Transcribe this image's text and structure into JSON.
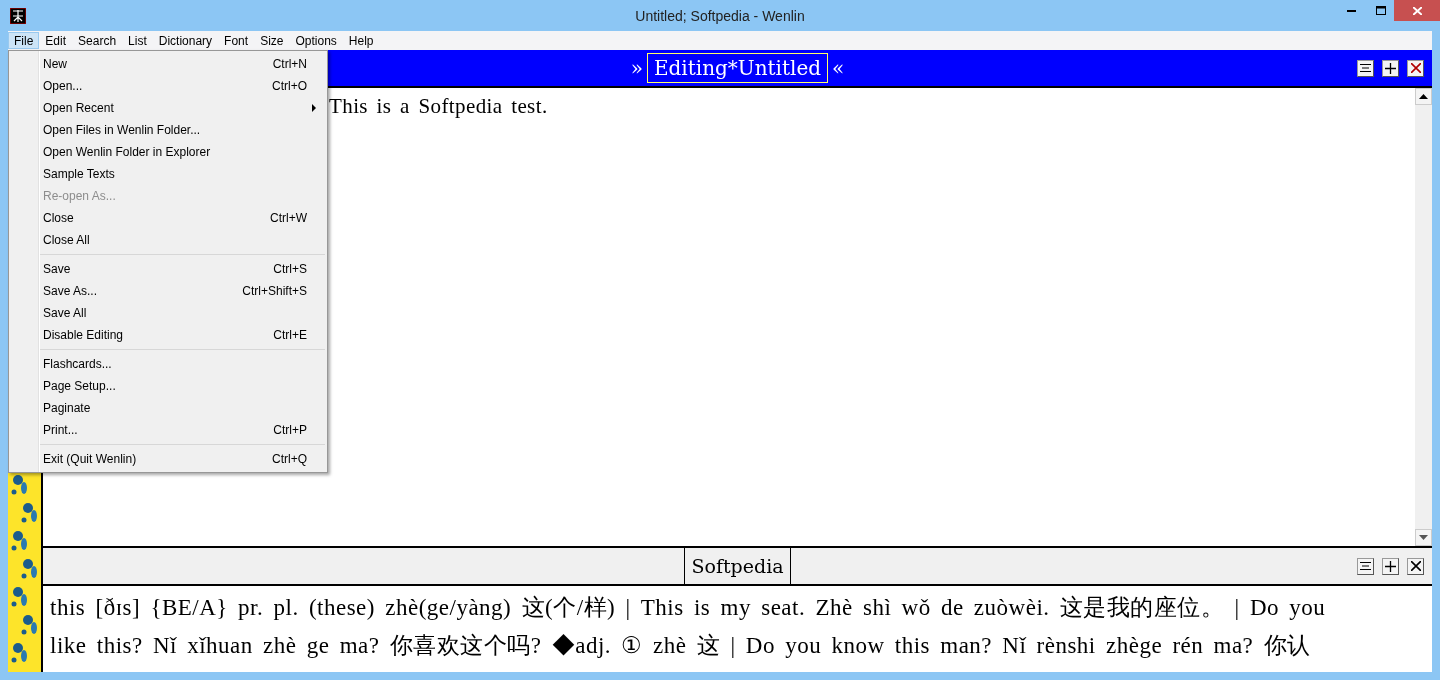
{
  "window": {
    "title": "Untitled; Softpedia - Wenlin"
  },
  "menu_bar": [
    {
      "label": "File",
      "selected": true
    },
    {
      "label": "Edit",
      "selected": false
    },
    {
      "label": "Search",
      "selected": false
    },
    {
      "label": "List",
      "selected": false
    },
    {
      "label": "Dictionary",
      "selected": false
    },
    {
      "label": "Font",
      "selected": false
    },
    {
      "label": "Size",
      "selected": false
    },
    {
      "label": "Options",
      "selected": false
    },
    {
      "label": "Help",
      "selected": false
    }
  ],
  "file_menu": [
    [
      {
        "label": "New",
        "shortcut": "Ctrl+N",
        "disabled": false,
        "submenu": false
      },
      {
        "label": "Open...",
        "shortcut": "Ctrl+O",
        "disabled": false,
        "submenu": false
      },
      {
        "label": "Open Recent",
        "disabled": false,
        "submenu": true
      },
      {
        "label": "Open Files in Wenlin Folder...",
        "disabled": false,
        "submenu": false
      },
      {
        "label": "Open Wenlin Folder in Explorer",
        "disabled": false,
        "submenu": false
      },
      {
        "label": "Sample Texts",
        "disabled": false,
        "submenu": false
      },
      {
        "label": "Re-open As...",
        "disabled": true,
        "submenu": false
      },
      {
        "label": "Close",
        "shortcut": "Ctrl+W",
        "disabled": false,
        "submenu": false
      },
      {
        "label": "Close All",
        "disabled": false,
        "submenu": false
      }
    ],
    [
      {
        "label": "Save",
        "shortcut": "Ctrl+S",
        "disabled": false,
        "submenu": false
      },
      {
        "label": "Save As...",
        "shortcut": "Ctrl+Shift+S",
        "disabled": false,
        "submenu": false
      },
      {
        "label": "Save All",
        "disabled": false,
        "submenu": false
      },
      {
        "label": "Disable Editing",
        "shortcut": "Ctrl+E",
        "disabled": false,
        "submenu": false
      }
    ],
    [
      {
        "label": "Flashcards...",
        "disabled": false,
        "submenu": false
      },
      {
        "label": "Page Setup...",
        "disabled": false,
        "submenu": false
      },
      {
        "label": "Paginate",
        "disabled": false,
        "submenu": false
      },
      {
        "label": "Print...",
        "shortcut": "Ctrl+P",
        "disabled": false,
        "submenu": false
      }
    ],
    [
      {
        "label": "Exit (Quit Wenlin)",
        "shortcut": "Ctrl+Q",
        "disabled": false,
        "submenu": false
      }
    ]
  ],
  "editor": {
    "mark_left": "»",
    "title": "Editing*Untitled",
    "mark_right": "«",
    "text": "This is a Softpedia test."
  },
  "dictionary_pane": {
    "title": "Softpedia",
    "lines": [
      "this [ðɪs] {BE/A} pr. pl. (these) zhè(ge/yàng) 这(个/样) | This is my seat. Zhè shì wǒ de zuòwèi. 这是我的座位。 | Do you",
      "like this? Nǐ xǐhuan zhè ge ma? 你喜欢这个吗? ◆adj. ① zhè 这 | Do you know this man? Nǐ rènshi zhège rén ma? 你认"
    ]
  }
}
